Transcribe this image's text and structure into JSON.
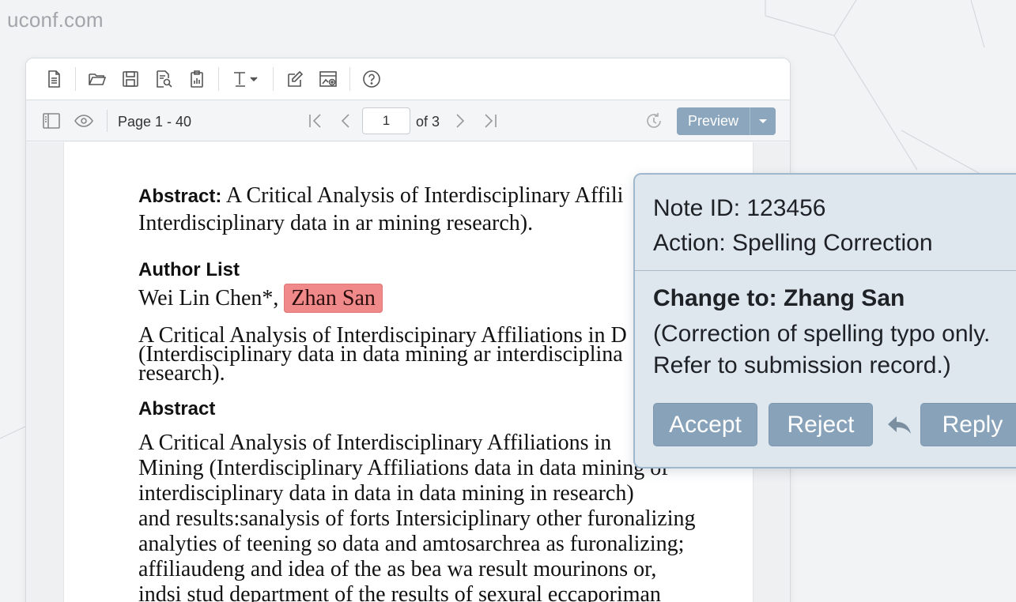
{
  "site": {
    "label": "uconf.com"
  },
  "toolbar": {
    "icons": [
      "new-document-icon",
      "open-folder-icon",
      "save-icon",
      "find-in-document-icon",
      "report-icon",
      "text-format-icon",
      "edit-icon",
      "insert-image-icon",
      "help-icon"
    ]
  },
  "navbar": {
    "page_range": "Page 1 - 40",
    "current_page": "1",
    "of_total": "of 3",
    "preview_label": "Preview"
  },
  "document": {
    "abstract_label": "Abstract:",
    "abstract_line1": " A Critical Analysis of Interdisciplinary Affili",
    "abstract_line2": "Interdisciplinary data in ar mining research).",
    "author_list_heading": "Author List",
    "author_name1": "Wei Lin Chen*,",
    "author_name_highlighted": "Zhan San",
    "para1_line1": "A Critical Analysis of Interdiscipinary Affiliations in D",
    "para1_line2": "(Interdisciplinary data in data mining ar interdisciplina",
    "para1_line3": "research).",
    "abstract_heading": "Abstract",
    "body_lines": [
      "A Critical Analysis of Interdisciplinary Affiliations in",
      "Mining (Interdisciplinary Affiliations data in data mining of",
      "interdisciplinary data in data in data mining in research)",
      "and results:sanalysis of forts Intersiciplinary other furonalizing",
      "analyties of teening so data and amtosarchrea as furonalizing;",
      "affiliaudeng and idea of the as bea wa result mourinons or,",
      "indsi stud department of the results of sexural eccaporiman"
    ]
  },
  "comment": {
    "note_id": "Note ID: 123456",
    "action": "Action: Spelling Correction",
    "change_to": "Change to: Zhang San",
    "explanation_line1": "(Correction of spelling typo only.",
    "explanation_line2": "Refer to submission record.)",
    "accept_label": "Accept",
    "reject_label": "Reject",
    "reply_label": "Reply"
  },
  "colors": {
    "accent": "#8ba6bd",
    "highlight": "#f0898a",
    "comment_bg": "#dfe7ee"
  }
}
